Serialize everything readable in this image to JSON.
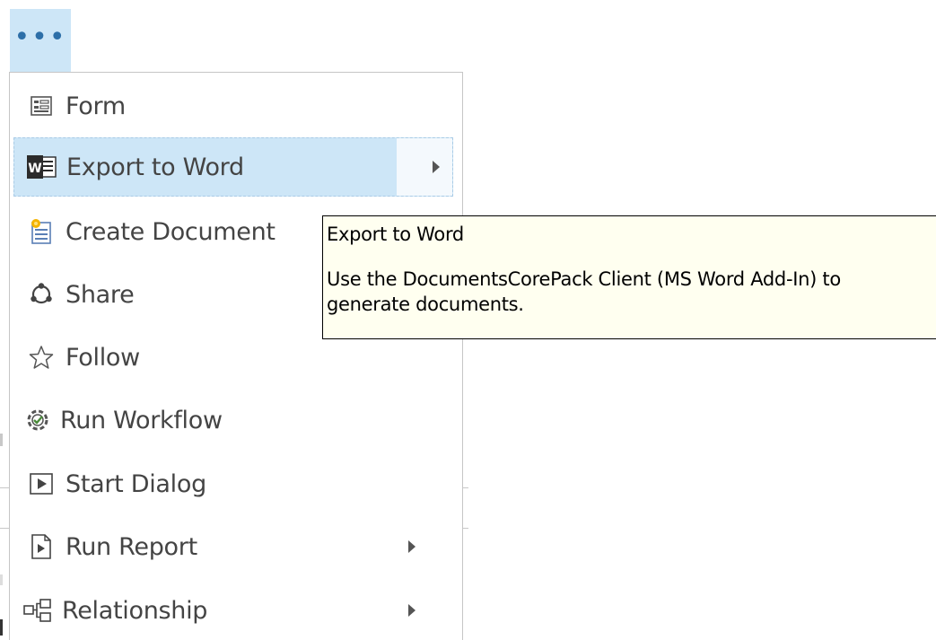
{
  "toolbar": {
    "more_button_label": "•••"
  },
  "menu": {
    "items": [
      {
        "label": "Form",
        "icon": "form-icon",
        "has_submenu": false,
        "highlighted": false
      },
      {
        "label": "Export to Word",
        "icon": "word-icon",
        "has_submenu": true,
        "highlighted": true
      },
      {
        "label": "Create Document",
        "icon": "create-document-icon",
        "has_submenu": false,
        "highlighted": false
      },
      {
        "label": "Share",
        "icon": "share-icon",
        "has_submenu": false,
        "highlighted": false
      },
      {
        "label": "Follow",
        "icon": "star-icon",
        "has_submenu": false,
        "highlighted": false
      },
      {
        "label": "Run Workflow",
        "icon": "workflow-icon",
        "has_submenu": false,
        "highlighted": false
      },
      {
        "label": "Start Dialog",
        "icon": "dialog-icon",
        "has_submenu": false,
        "highlighted": false
      },
      {
        "label": "Run Report",
        "icon": "report-icon",
        "has_submenu": true,
        "highlighted": false
      },
      {
        "label": "Relationship",
        "icon": "relationship-icon",
        "has_submenu": true,
        "highlighted": false
      }
    ]
  },
  "tooltip": {
    "title": "Export to Word",
    "body_line1": "Use the DocumentsCorePack Client (MS Word Add-In) to",
    "body_line2": "generate documents."
  },
  "colors": {
    "highlight": "#cde6f7",
    "tooltip_background": "#fffff0",
    "text": "#444444",
    "word_blue": "#2b579a"
  }
}
